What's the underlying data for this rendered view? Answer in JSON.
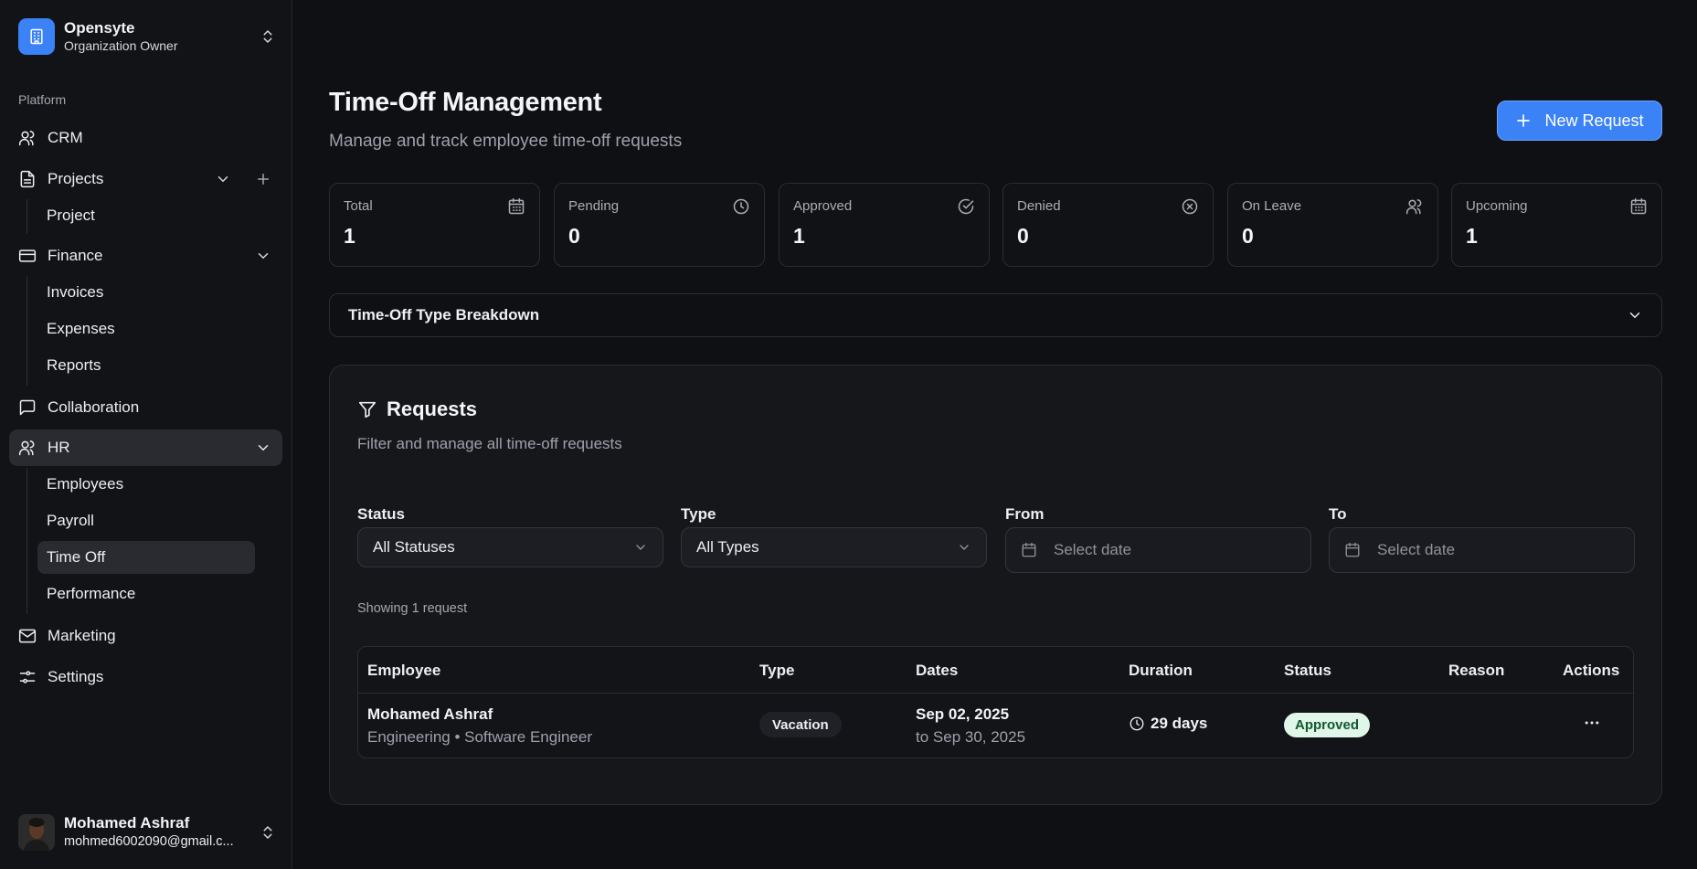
{
  "org": {
    "name": "Opensyte",
    "role": "Organization Owner"
  },
  "sidebar": {
    "section_label": "Platform",
    "crm": "CRM",
    "projects": "Projects",
    "project": "Project",
    "finance": "Finance",
    "invoices": "Invoices",
    "expenses": "Expenses",
    "reports": "Reports",
    "collaboration": "Collaboration",
    "hr": "HR",
    "employees": "Employees",
    "payroll": "Payroll",
    "time_off": "Time Off",
    "performance": "Performance",
    "marketing": "Marketing",
    "settings": "Settings"
  },
  "user": {
    "name": "Mohamed Ashraf",
    "email": "mohmed6002090@gmail.c..."
  },
  "header": {
    "title": "Time-Off Management",
    "subtitle": "Manage and track employee time-off requests",
    "new_request": "New Request"
  },
  "stats": [
    {
      "label": "Total",
      "value": "1",
      "icon": "calendar-icon"
    },
    {
      "label": "Pending",
      "value": "0",
      "icon": "clock-icon"
    },
    {
      "label": "Approved",
      "value": "1",
      "icon": "check-circle-icon"
    },
    {
      "label": "Denied",
      "value": "0",
      "icon": "x-circle-icon"
    },
    {
      "label": "On Leave",
      "value": "0",
      "icon": "users-icon"
    },
    {
      "label": "Upcoming",
      "value": "1",
      "icon": "calendar-icon"
    }
  ],
  "breakdown": {
    "label": "Time-Off Type Breakdown"
  },
  "requests": {
    "title": "Requests",
    "subtitle": "Filter and manage all time-off requests",
    "filters": {
      "status_label": "Status",
      "status_value": "All Statuses",
      "type_label": "Type",
      "type_value": "All Types",
      "from_label": "From",
      "from_placeholder": "Select date",
      "to_label": "To",
      "to_placeholder": "Select date"
    },
    "showing": "Showing 1 request",
    "columns": {
      "employee": "Employee",
      "type": "Type",
      "dates": "Dates",
      "duration": "Duration",
      "status": "Status",
      "reason": "Reason",
      "actions": "Actions"
    },
    "rows": [
      {
        "name": "Mohamed Ashraf",
        "dept": "Engineering • Software Engineer",
        "type": "Vacation",
        "date_start": "Sep 02, 2025",
        "date_end": "to Sep 30, 2025",
        "duration": "29 days",
        "status": "Approved",
        "reason": ""
      }
    ]
  },
  "colors": {
    "accent": "#3b82f6",
    "approved_bg": "#dff6e8",
    "approved_text": "#13582f"
  }
}
